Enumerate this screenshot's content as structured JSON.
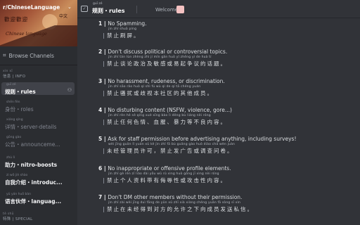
{
  "server": {
    "name": "r/ChineseLanguage",
    "banner_text_1": "歡迎歡迎",
    "banner_text_2": "Chinese language",
    "banner_text_3": "中文"
  },
  "sidebar": {
    "browse_label": "Browse Channels",
    "categories": [
      {
        "pinyin": "xìn xī",
        "label": "信息 | INFO"
      },
      {
        "pinyin": "tè shū",
        "label": "特殊 | SPECIAL"
      }
    ],
    "channels": [
      {
        "pinyin": "guī zé",
        "label": "规则・rules"
      },
      {
        "pinyin": "shēn fèn",
        "label": "身份・roles"
      },
      {
        "pinyin": "xiáng qíng",
        "label": "详情・server-details"
      },
      {
        "pinyin": "gōng gào",
        "label": "公告・announceme..."
      },
      {
        "pinyin": "zhù lì",
        "label": "助力・nitro-boosts"
      },
      {
        "pinyin": "zì wǒ jiè shào",
        "label": "自我介绍・introduc..."
      },
      {
        "pinyin": "yǔ yán huǒ bàn",
        "label": "语言伙伴・languag..."
      }
    ]
  },
  "header": {
    "pinyin": "guī zé",
    "title": "规则・rules",
    "topic": "Welcome!"
  },
  "rules": [
    {
      "num": "1",
      "en": "No Spamming.",
      "py": "jìn zhǐ shuā píng",
      "zh": "禁止刷屏。"
    },
    {
      "num": "2",
      "en": "Don't discuss political or controversial topics.",
      "py": "jìn zhǐ tán lùn zhèng zhì jí mǐn gǎn huò yǐ zhēng yì de huà tí",
      "zh": "禁止谈论政治及敏感或易起争议的话题。"
    },
    {
      "num": "3",
      "en": "No harassment, rudeness, or discrimination.",
      "py": "jìn zhǐ sāo rǎo huò qí shì fú wù qì de qí tā chéng yuán",
      "zh": "禁止骚扰或歧视本社区的其他成员。"
    },
    {
      "num": "4",
      "en": "No disturbing content (NSFW, violence, gore...)",
      "py": "jìn zhǐ rèn hé sè qíng xuè xīng bào lì děng bù liáng nèi róng",
      "zh": "禁止任何色情、血腥、暴力等不良内容。"
    },
    {
      "num": "5",
      "en": "Ask for staff permission before advertising anything, including surveys!",
      "py": "wèi jīng guǎn lǐ yuán xǔ kě jìn zhǐ fā bù guǎng gào huò diào chá wèn juàn",
      "zh": "未经管理员许可，禁止发广告或调查问卷。"
    },
    {
      "num": "6",
      "en": "No inappropriate or offensive profile elements.",
      "py": "jìn zhǐ gè rén zī liào dài yǒu wǔ rǔ xìng huò gōng jī xìng nèi róng",
      "zh": "禁止个人资料带有侮辱性或攻击性内容。"
    },
    {
      "num": "7",
      "en": "Don't DM other members without their permission.",
      "py": "jìn zhǐ zài wèi jīng duì fāng de yǔn xǔ zhī xià xiàng chéng yuán fā sòng sī xìn",
      "zh": "禁止在未经得到对方的允许之下向成员发送私信。"
    }
  ]
}
